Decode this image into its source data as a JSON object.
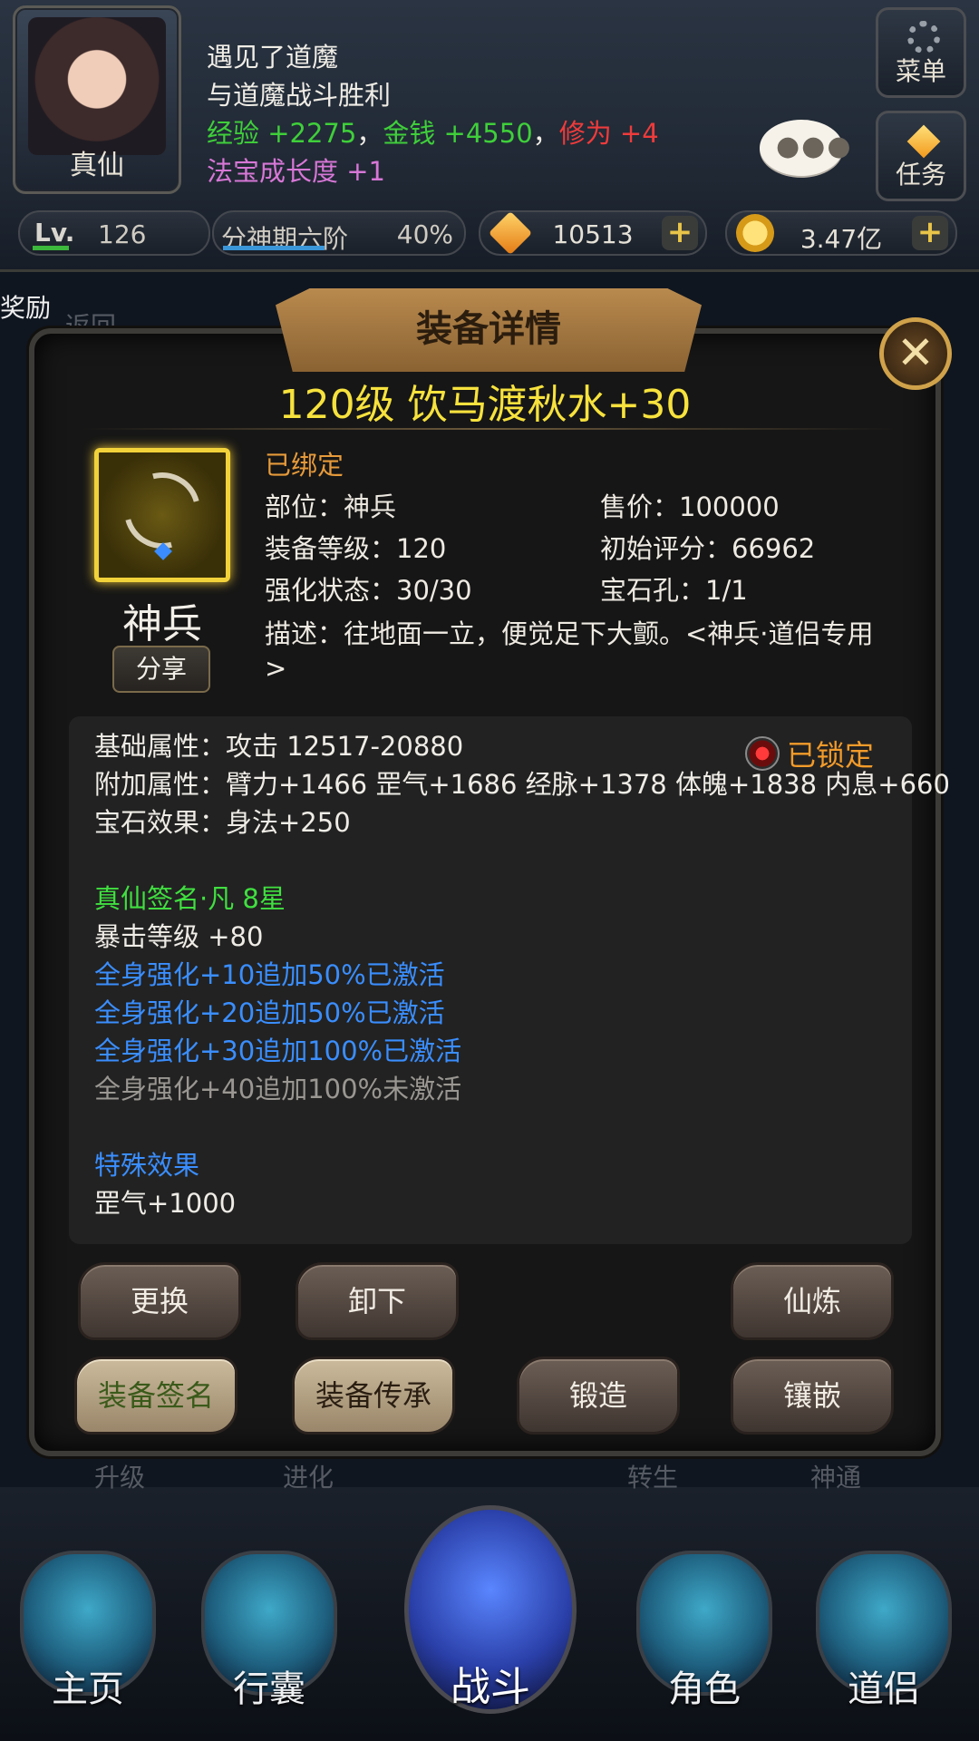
{
  "player": {
    "name": "真仙",
    "level_tag": "Lv.",
    "level": "126",
    "rank": "分神期六阶",
    "rank_progress": "40%",
    "gems": "10513",
    "coins": "3.47亿"
  },
  "battle_log": {
    "line1": "遇见了道魔",
    "line2": "与道魔战斗胜利",
    "exp": "经验 +2275",
    "sep1": "，",
    "money": "金钱 +4550",
    "sep2": "，",
    "cultivation": "修为 +4",
    "treasure": "法宝成长度 +1"
  },
  "side_buttons": {
    "menu": "菜单",
    "task": "任务"
  },
  "background": {
    "reward": "奖励",
    "back": "返回",
    "bottom_labels": [
      "升级",
      "进化",
      "转生",
      "神通"
    ]
  },
  "modal": {
    "header": "装备详情",
    "item_title": "120级 饮马渡秋水+30",
    "item_type": "神兵",
    "share": "分享",
    "bound": "已绑定",
    "slot": "部位：神兵",
    "price": "售价：100000",
    "equip_level": "装备等级：120",
    "initial_score": "初始评分：66962",
    "enhance": "强化状态：30/30",
    "gem_slots": "宝石孔：1/1",
    "desc_line1": "描述：往地面一立，便觉足下大颤。<神兵·道侣专用",
    "desc_line2": ">",
    "locked": "已锁定",
    "attrs": {
      "base": "基础属性：攻击 12517-20880",
      "extra": "附加属性：臂力+1466 罡气+1686 经脉+1378 体魄+1838 内息+660",
      "gem": "宝石效果：身法+250",
      "signature": "真仙签名·凡 8星",
      "crit": "暴击等级 +80",
      "set1": "全身强化+10追加50%已激活",
      "set2": "全身强化+20追加50%已激活",
      "set3": "全身强化+30追加100%已激活",
      "set4": "全身强化+40追加100%未激活",
      "special_title": "特殊效果",
      "special": "罡气+1000"
    },
    "buttons": {
      "replace": "更换",
      "unequip": "卸下",
      "refine": "仙炼",
      "sign": "装备签名",
      "inherit": "装备传承",
      "forge": "锻造",
      "inlay": "镶嵌"
    }
  },
  "nav": {
    "home": "主页",
    "bag": "行囊",
    "battle": "战斗",
    "role": "角色",
    "partner": "道侣"
  },
  "colors": {
    "title_yellow": "#f7e23d",
    "bound_orange": "#e69a3a",
    "green": "#40e040",
    "blue": "#3a8eff",
    "gray": "#9a9792"
  }
}
